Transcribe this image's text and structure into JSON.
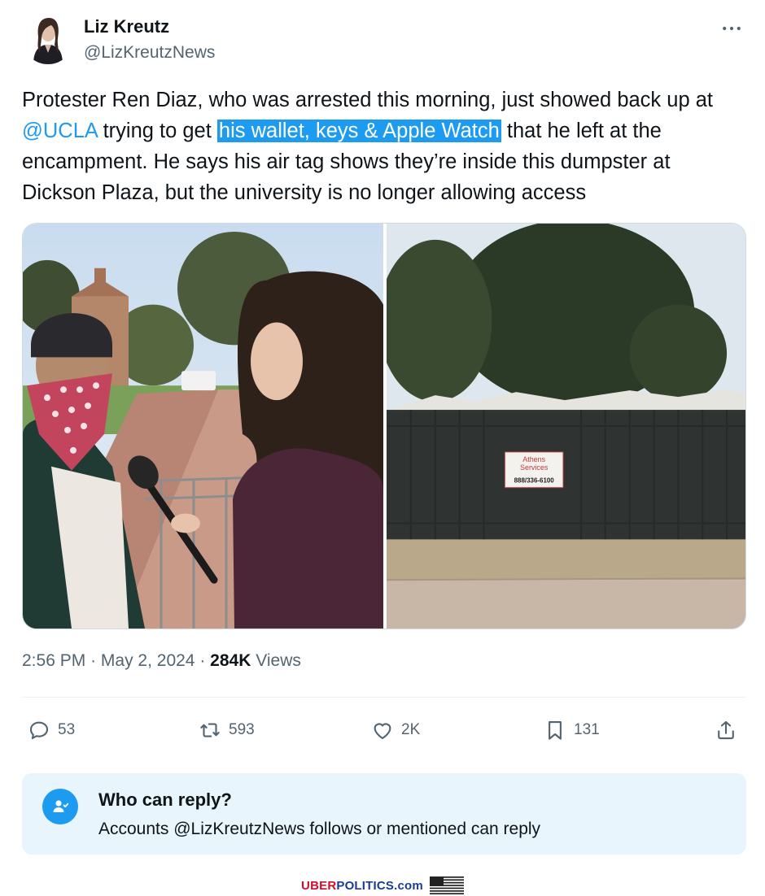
{
  "author": {
    "display_name": "Liz Kreutz",
    "handle": "@LizKreutzNews",
    "avatar_icon": "profile-photo"
  },
  "tweet": {
    "text_part1": "Protester Ren Diaz, who was arrested this morning, just showed back up at ",
    "mention": "@UCLA",
    "text_part2": " trying to get ",
    "highlighted": "his wallet, keys & Apple Watch",
    "text_part3": " that he left at the encampment. He says his air tag shows they’re inside this dumpster at Dickson Plaza, but the university is no longer allowing access"
  },
  "media": {
    "left_alt": "Protester in bandana being interviewed by reporter with microphone",
    "right_alt": "Dumpster at Dickson Plaza",
    "dumpster_sign_line1": "Athens",
    "dumpster_sign_line2": "Services",
    "dumpster_sign_phone": "888/336-6100"
  },
  "meta": {
    "time": "2:56 PM",
    "separator": "·",
    "date": "May 2, 2024",
    "views_count": "284K",
    "views_label": "Views"
  },
  "actions": {
    "replies": "53",
    "reposts": "593",
    "likes": "2K",
    "bookmarks": "131"
  },
  "reply_restriction": {
    "title": "Who can reply?",
    "description": "Accounts @LizKreutzNews follows or mentioned can reply"
  },
  "watermark": {
    "uber": "UBER",
    "politics": "POLITICS",
    "dotcom": ".com"
  },
  "colors": {
    "accent": "#1d9bf0",
    "text_primary": "#0f1419",
    "text_secondary": "#536471",
    "reply_box_bg": "#e8f5fd"
  }
}
